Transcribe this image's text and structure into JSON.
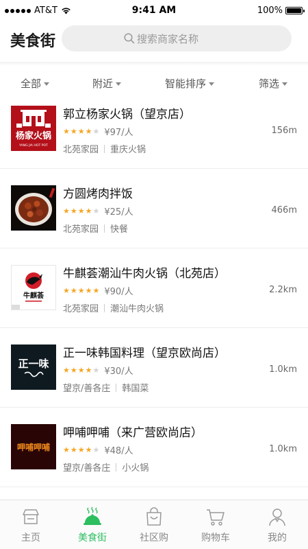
{
  "status_bar": {
    "carrier": "AT&T",
    "time": "9:41 AM",
    "battery": "100%",
    "signal_bars": 5
  },
  "header": {
    "logo": "美食街",
    "search_placeholder": "搜索商家名称"
  },
  "filters": [
    {
      "label": "全部"
    },
    {
      "label": "附近"
    },
    {
      "label": "智能排序"
    },
    {
      "label": "筛选"
    }
  ],
  "restaurants": [
    {
      "name": "郭立杨家火锅（望京店）",
      "rating": 4,
      "price": "¥97/人",
      "distance": "156m",
      "area": "北苑家园",
      "category": "重庆火锅",
      "logo_text": "杨家火锅",
      "logo_sub": "YANG JIA HOT POT"
    },
    {
      "name": "方圆烤肉拌饭",
      "rating": 4,
      "price": "¥25/人",
      "distance": "466m",
      "area": "北苑家园",
      "category": "快餐"
    },
    {
      "name": "牛麒荟潮汕牛肉火锅（北苑店）",
      "rating": 5,
      "price": "¥90/人",
      "distance": "2.2km",
      "area": "北苑家园",
      "category": "潮汕牛肉火锅",
      "logo_text": "牛麒荟"
    },
    {
      "name": "正一味韩国料理（望京欧尚店）",
      "rating": 4,
      "price": "¥30/人",
      "distance": "1.0km",
      "area": "望京/善各庄",
      "category": "韩国菜",
      "logo_text": "正一味"
    },
    {
      "name": "呷哺呷哺（来广营欧尚店）",
      "rating": 4,
      "price": "¥48/人",
      "distance": "1.0km",
      "area": "望京/善各庄",
      "category": "小火锅",
      "logo_text": "呷哺呷哺"
    }
  ],
  "tabs": [
    {
      "label": "主页",
      "icon": "home-icon",
      "active": false
    },
    {
      "label": "美食街",
      "icon": "food-cloche-icon",
      "active": true
    },
    {
      "label": "社区购",
      "icon": "shopping-bag-icon",
      "active": false
    },
    {
      "label": "购物车",
      "icon": "cart-icon",
      "active": false
    },
    {
      "label": "我的",
      "icon": "user-icon",
      "active": false
    }
  ],
  "colors": {
    "accent": "#2dbe60",
    "star": "#f5a623",
    "star_off": "#d3d3d3",
    "search_bg": "#eeeeee"
  }
}
